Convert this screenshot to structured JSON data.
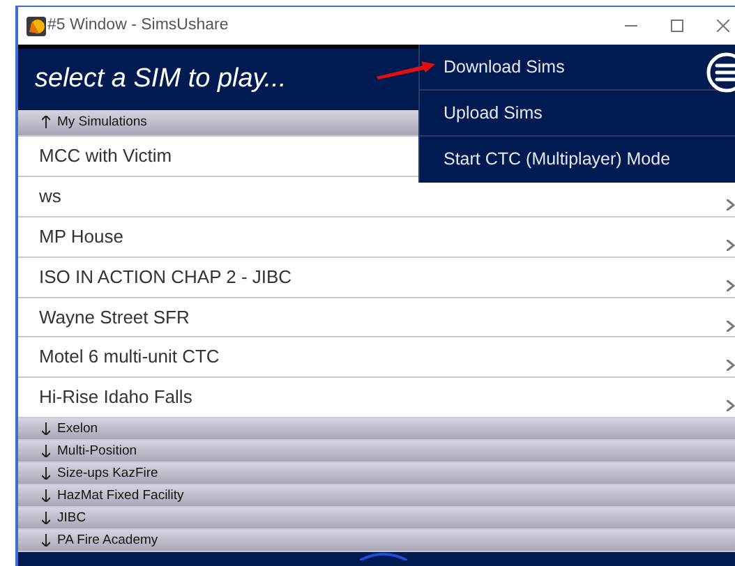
{
  "window": {
    "title": "#5 Window - SimsUshare"
  },
  "header": {
    "title": "select a SIM to play..."
  },
  "menu": {
    "items": [
      {
        "label": "Download Sims",
        "pointed": true
      },
      {
        "label": "Upload Sims",
        "pointed": false
      },
      {
        "label": "Start CTC (Multiplayer) Mode",
        "pointed": false
      }
    ]
  },
  "groups": [
    {
      "label": "My Simulations",
      "expanded": true,
      "items": [
        "MCC with Victim",
        "ws",
        "MP House",
        "ISO IN ACTION CHAP 2 - JIBC",
        "Wayne Street SFR",
        "Motel 6 multi-unit CTC",
        "Hi-Rise Idaho Falls"
      ]
    },
    {
      "label": "Exelon",
      "expanded": false
    },
    {
      "label": "Multi-Position",
      "expanded": false
    },
    {
      "label": "Size-ups KazFire",
      "expanded": false
    },
    {
      "label": "HazMat Fixed Facility",
      "expanded": false
    },
    {
      "label": "JIBC",
      "expanded": false
    },
    {
      "label": "PA Fire Academy",
      "expanded": false
    }
  ]
}
